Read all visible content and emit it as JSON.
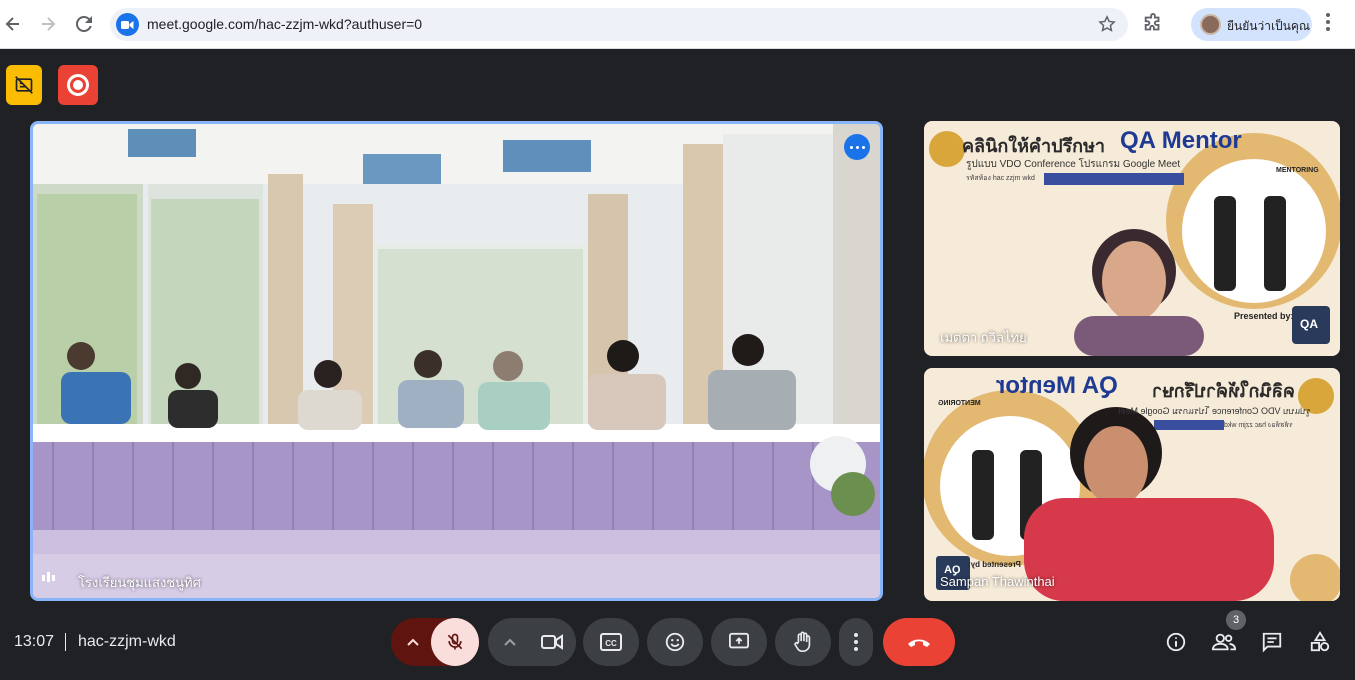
{
  "browser": {
    "url": "meet.google.com/hac-zzjm-wkd?authuser=0",
    "profile_label": "ยืนยันว่าเป็นคุณ"
  },
  "tiles": {
    "main": {
      "name": "โรงเรียนชุมแสงชนูทิศ"
    },
    "participant_a": {
      "name": "เมตตา ถวิลไทย"
    },
    "participant_b": {
      "name": "Sampan Thawinthai"
    }
  },
  "poster": {
    "heading_th": "คลินิกให้คำปรึกษา",
    "heading_en": "QA Mentor",
    "subline": "รูปแบบ VDO Conference โปรแกรม Google Meet",
    "code_line": "รหัสห้อง hac zzjm wkd",
    "presented_by": "Presented by:",
    "mentoring": "MENTORING",
    "qa": "QA"
  },
  "bottom_bar": {
    "time": "13:07",
    "meeting_code": "hac-zzjm-wkd",
    "participant_count": "3"
  },
  "colors": {
    "accent": "#1a73e8",
    "leave": "#ea4335",
    "mic_off_bg": "#f9dedc",
    "mic_caret_bg": "#601410",
    "record_badge": "#ea4335",
    "warning_badge": "#fbbc04"
  }
}
